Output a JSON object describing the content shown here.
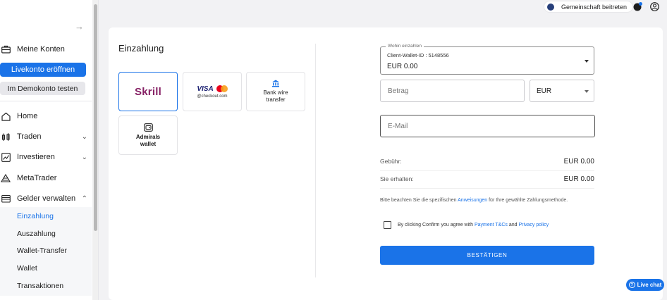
{
  "header": {
    "community_label": "Gemeinschaft beitreten"
  },
  "sidebar": {
    "collapse_icon": "arrow-right-icon",
    "accounts_label": "Meine Konten",
    "live_button": "Livekonto eröffnen",
    "demo_button": "Im Demokonto testen",
    "items": [
      {
        "label": "Home",
        "icon": "home-icon"
      },
      {
        "label": "Traden",
        "icon": "candles-icon"
      },
      {
        "label": "Investieren",
        "icon": "chart-icon"
      },
      {
        "label": "MetaTrader",
        "icon": "metatrader-icon"
      },
      {
        "label": "Gelder verwalten",
        "icon": "wallet-icon"
      }
    ],
    "sub_items": [
      {
        "label": "Einzahlung",
        "active": true
      },
      {
        "label": "Auszahlung"
      },
      {
        "label": "Wallet-Transfer"
      },
      {
        "label": "Wallet"
      },
      {
        "label": "Transaktionen"
      }
    ]
  },
  "deposit": {
    "title": "Einzahlung",
    "methods": {
      "skrill": "Skrill",
      "visa": "VISA",
      "checkout": "@checkout.com",
      "bank_wire_1": "Bank wire",
      "bank_wire_2": "transfer",
      "admirals_1": "Admirals",
      "admirals_2": "wallet"
    }
  },
  "form": {
    "wallet_legend": "Wohin einzahlen",
    "wallet_id": "Client-Wallet-ID : 5148556",
    "wallet_value": "EUR 0.00",
    "amount_placeholder": "Betrag",
    "currency_value": "EUR",
    "email_placeholder": "E-Mail",
    "fee_label": "Gebühr:",
    "fee_value": "EUR 0.00",
    "receive_label": "Sie erhalten:",
    "receive_value": "EUR 0.00",
    "hint_before": "Bitte beachten Sie die spezifischen ",
    "hint_link": "Anweisungen",
    "hint_after": " für Ihre gewählte Zahlungsmethode.",
    "agree_before": "By clicking Confirm you agree with ",
    "agree_link1": "Payment T&Cs",
    "agree_and": " and ",
    "agree_link2": "Privacy policy",
    "confirm_button": "BESTÄTIGEN"
  },
  "live_chat": "Live chat",
  "colors": {
    "accent": "#1a73e8",
    "skrill": "#862165"
  }
}
